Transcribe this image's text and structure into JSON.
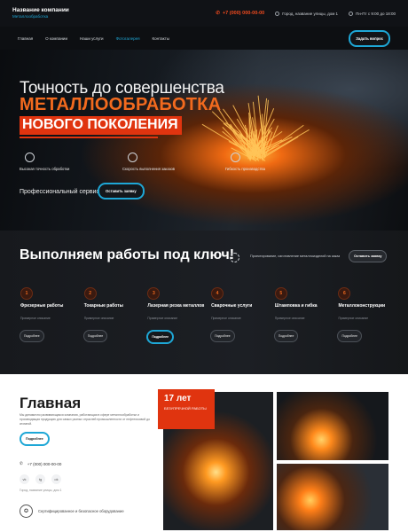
{
  "header": {
    "company_name": "Название компании",
    "company_sub": "Металлообработка",
    "phone": "+7 (000) 000-00-00",
    "address": "Город, название улицы, дом 1",
    "hours": "Пн-Пт с 9:00 до 18:00"
  },
  "nav": {
    "items": [
      "Главная",
      "О компании",
      "Наши услуги",
      "Фотогалерея",
      "Контакты"
    ],
    "active_index": 3,
    "ask_button": "Задать вопрос"
  },
  "hero": {
    "line1": "Точность до совершенства",
    "line2": "МЕТАЛЛООБРАБОТКА",
    "line3": "НОВОГО ПОКОЛЕНИЯ",
    "features": [
      "Высокая точность обработки",
      "Скорость выполнения заказов",
      "Гибкость производства"
    ],
    "feature_icons": [
      "award-icon",
      "clock-icon",
      "settings-icon"
    ],
    "pro_text": "Профессиональный сервис",
    "call_button": "Оставить заявку"
  },
  "works": {
    "title": "Выполняем работы под ключ!",
    "desc": "Проектирование, изготовление металлоизделий на заказ",
    "button": "Оставить заявку",
    "services": [
      {
        "num": "1",
        "name": "Фрезерные работы",
        "sub": "Примерное описание",
        "more": "Подробнее",
        "active": false
      },
      {
        "num": "2",
        "name": "Токарные работы",
        "sub": "Примерное описание",
        "more": "Подробнее",
        "active": false
      },
      {
        "num": "3",
        "name": "Лазерная резка металлов",
        "sub": "Примерное описание",
        "more": "Подробнее",
        "active": true
      },
      {
        "num": "4",
        "name": "Сварочные услуги",
        "sub": "Примерное описание",
        "more": "Подробнее",
        "active": false
      },
      {
        "num": "5",
        "name": "Штамповка и гибка",
        "sub": "Примерное описание",
        "more": "Подробнее",
        "active": false
      },
      {
        "num": "6",
        "name": "Металлоконструкции",
        "sub": "Примерное описание",
        "more": "Подробнее",
        "active": false
      }
    ]
  },
  "main": {
    "title": "Главная",
    "text": "Мы динамично развивающаяся компания, работающая в сфере металлообработки и производящая продукцию для самых разных отраслей промышленности от нефтегазовой до атомной.",
    "button": "Подробнее",
    "phone": "+7 (000) 000-00-00",
    "socials": [
      "vk",
      "tg",
      "ok"
    ],
    "address": "Город, название улицы, дом 1",
    "cert": "Сертифицированное и безопасное оборудование",
    "years_big": "17 лет",
    "years_small": "БЕЗУПРЕЧНОЙ РАБОТЫ"
  },
  "colors": {
    "accent": "#1ea7d6",
    "brand": "#e0340f",
    "orange": "#f26a1e"
  }
}
